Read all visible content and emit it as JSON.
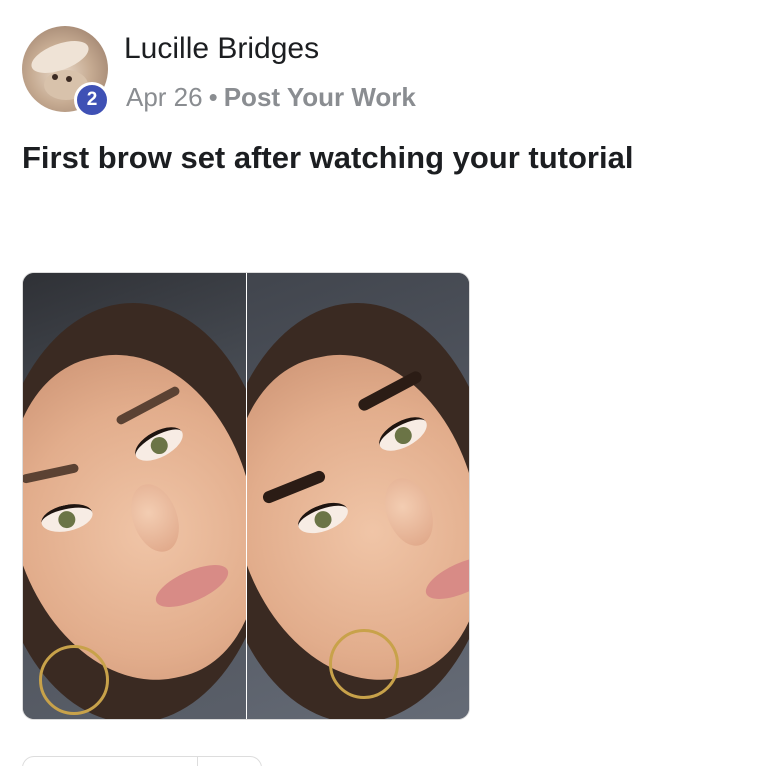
{
  "post": {
    "author_name": "Lucille Bridges",
    "badge_count": "2",
    "date": "Apr 26",
    "separator": "•",
    "topic": "Post Your Work",
    "text": "First brow set after watching your tutorial"
  },
  "colors": {
    "badge": "#3f51b5",
    "text_primary": "#1c1e21",
    "text_secondary": "#8a8d91"
  },
  "icons": {
    "avatar": "profile-photo",
    "image": "before-after-brow-photo"
  }
}
